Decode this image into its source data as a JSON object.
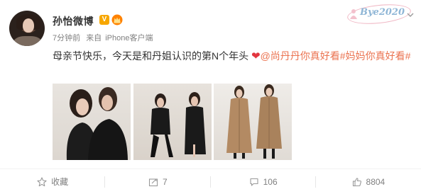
{
  "post": {
    "username": "孙怡微博",
    "verified_badge": "V",
    "timestamp": "7分钟前",
    "source_prefix": "来自",
    "source": "iPhone客户端",
    "text_main": "母亲节快乐，今天是和丹姐认识的第N个年头",
    "text_mention": "@尚丹丹你真好看",
    "text_hashtag": "#妈妈你真好看#"
  },
  "watermark": "Bye2020",
  "actions": {
    "favorite_label": "收藏",
    "repost_count": "7",
    "comment_count": "106",
    "like_count": "8804"
  },
  "icons": [
    "crown-badge-icon",
    "chevron-down-icon",
    "star-icon",
    "repost-icon",
    "comment-icon",
    "thumbs-up-icon"
  ],
  "colors": {
    "link": "#eb7350",
    "heart": "#e2363f",
    "verified": "#f7a700",
    "muted_text": "#808080"
  }
}
